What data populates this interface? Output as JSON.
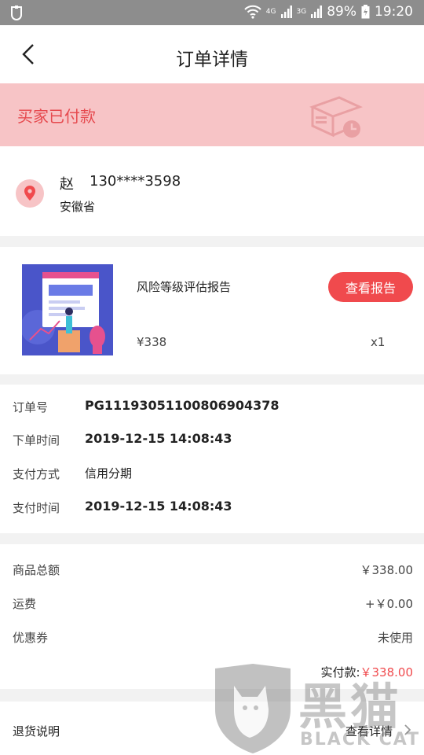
{
  "status_bar": {
    "battery": "89%",
    "time": "19:20",
    "network_a": "4G",
    "network_b": "3G"
  },
  "header": {
    "title": "订单详情"
  },
  "banner": {
    "status": "买家已付款"
  },
  "address": {
    "name": "赵",
    "phone": "130****3598",
    "detail": "安徽省"
  },
  "product": {
    "name": "风险等级评估报告",
    "button": "查看报告",
    "price": "¥338",
    "quantity": "x1"
  },
  "order_info": [
    {
      "label": "订单号",
      "value": "PG11193051100806904378"
    },
    {
      "label": "下单时间",
      "value": "2019-12-15 14:08:43"
    },
    {
      "label": "支付方式",
      "value": "信用分期"
    },
    {
      "label": "支付时间",
      "value": "2019-12-15 14:08:43"
    }
  ],
  "costs": [
    {
      "label": "商品总额",
      "value": "￥338.00"
    },
    {
      "label": "运费",
      "value": "+￥0.00"
    },
    {
      "label": "优惠券",
      "value": "未使用"
    }
  ],
  "total": {
    "label": "实付款:",
    "amount": "￥338.00"
  },
  "return_policy": {
    "label": "退货说明",
    "link": "查看详情"
  },
  "watermark": {
    "cn": "黑猫",
    "en": "BLACK CAT"
  },
  "colors": {
    "accent": "#f04a4d",
    "banner_bg": "#f7c4c6",
    "status_bar": "#8d8d8d"
  }
}
